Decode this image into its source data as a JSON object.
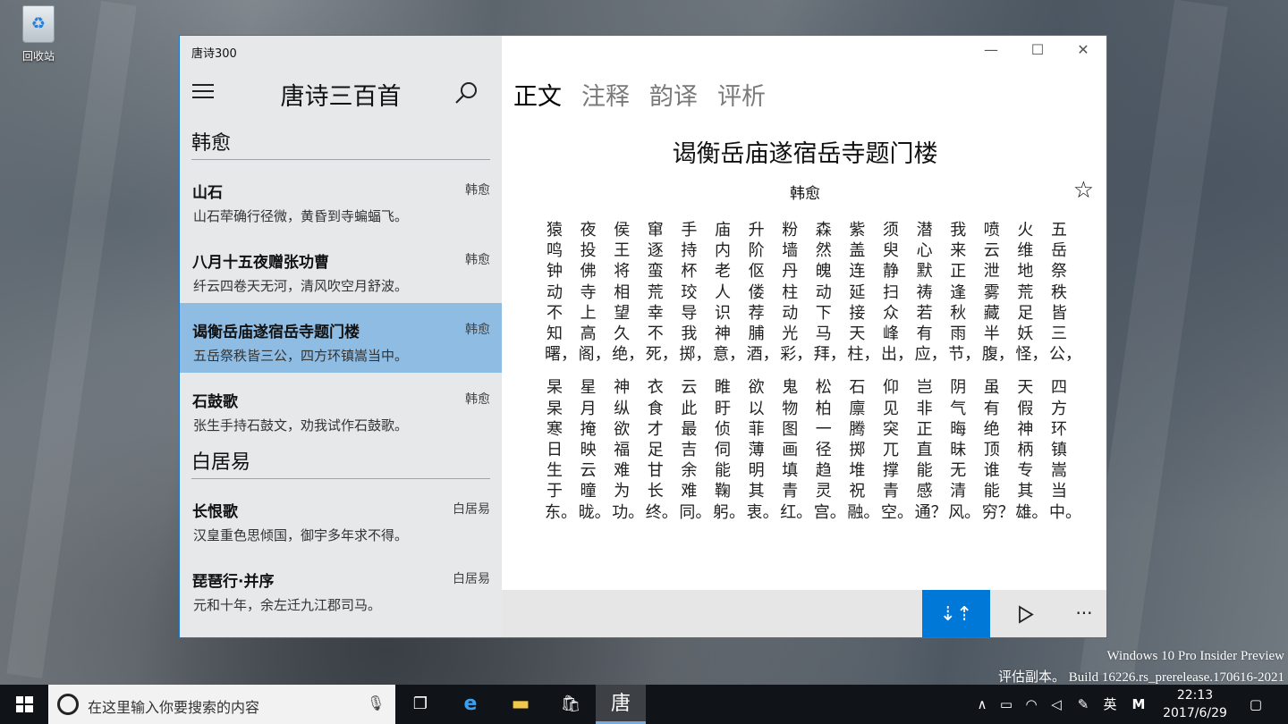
{
  "desktop": {
    "recycle_bin_label": "回收站"
  },
  "app": {
    "title": "唐诗300",
    "list_title": "唐诗三百首",
    "sections": [
      {
        "author": "韩愈",
        "poems": [
          {
            "title": "山石",
            "author": "韩愈",
            "first_line": "山石荦确行径微，黄昏到寺蝙蝠飞。",
            "selected": false
          },
          {
            "title": "八月十五夜赠张功曹",
            "author": "韩愈",
            "first_line": "纤云四卷天无河，清风吹空月舒波。",
            "selected": false
          },
          {
            "title": "谒衡岳庙遂宿岳寺题门楼",
            "author": "韩愈",
            "first_line": "五岳祭秩皆三公，四方环镇嵩当中。",
            "selected": true
          },
          {
            "title": "石鼓歌",
            "author": "韩愈",
            "first_line": "张生手持石鼓文，劝我试作石鼓歌。",
            "selected": false
          }
        ]
      },
      {
        "author": "白居易",
        "poems": [
          {
            "title": "长恨歌",
            "author": "白居易",
            "first_line": "汉皇重色思倾国，御宇多年求不得。",
            "selected": false
          },
          {
            "title": "琵琶行·并序",
            "author": "白居易",
            "first_line": "元和十年，余左迁九江郡司马。",
            "selected": false
          }
        ]
      }
    ],
    "tabs": [
      "正文",
      "注释",
      "韵译",
      "评析"
    ],
    "active_tab": "正文",
    "poem": {
      "title": "谒衡岳庙遂宿岳寺题门楼",
      "author": "韩愈",
      "columns": [
        "五岳祭秩皆三公，四方环镇嵩当中。",
        "火维地荒足妖怪，天假神柄专其雄。",
        "喷云泄雾藏半腹，虽有绝顶谁能穷？",
        "我来正逢秋雨节，阴气晦昧无清风。",
        "潜心默祷若有应，岂非正直能感通？",
        "须臾静扫众峰出，仰见突兀撑青空。",
        "紫盖连延接天柱，石廪腾掷堆祝融。",
        "森然魄动下马拜，松柏一径趋灵宫。",
        "粉墙丹柱动光彩，鬼物图画填青红。",
        "升阶伛偻荐脯酒，欲以菲薄明其衷。",
        "庙内老人识神意，睢盱侦伺能鞠躬。",
        "手持杯珓导我掷，云此最吉余难同。",
        "窜逐蛮荒幸不死，衣食才足甘长终。",
        "侯王将相望久绝，神纵欲福难为功。",
        "夜投佛寺上高阁，星月掩映云曈昽。",
        "猿鸣钟动不知曙，杲杲寒日生于东。"
      ]
    },
    "commands": {
      "sort_icon": "⇣⇡",
      "play_icon": "play-icon",
      "more": "···"
    },
    "window_controls": {
      "minimize": "—",
      "maximize": "☐",
      "close": "✕"
    }
  },
  "watermark": {
    "line1": "Windows 10 Pro Insider Preview",
    "line2": "评估副本。 Build 16226.rs_prerelease.170616-2021"
  },
  "taskbar": {
    "search_placeholder": "在这里输入你要搜索的内容",
    "active_app_glyph": "唐",
    "ime": "英",
    "ime_mode": "M",
    "time": "22:13",
    "date": "2017/6/29",
    "accent_color": "#0078d7"
  }
}
